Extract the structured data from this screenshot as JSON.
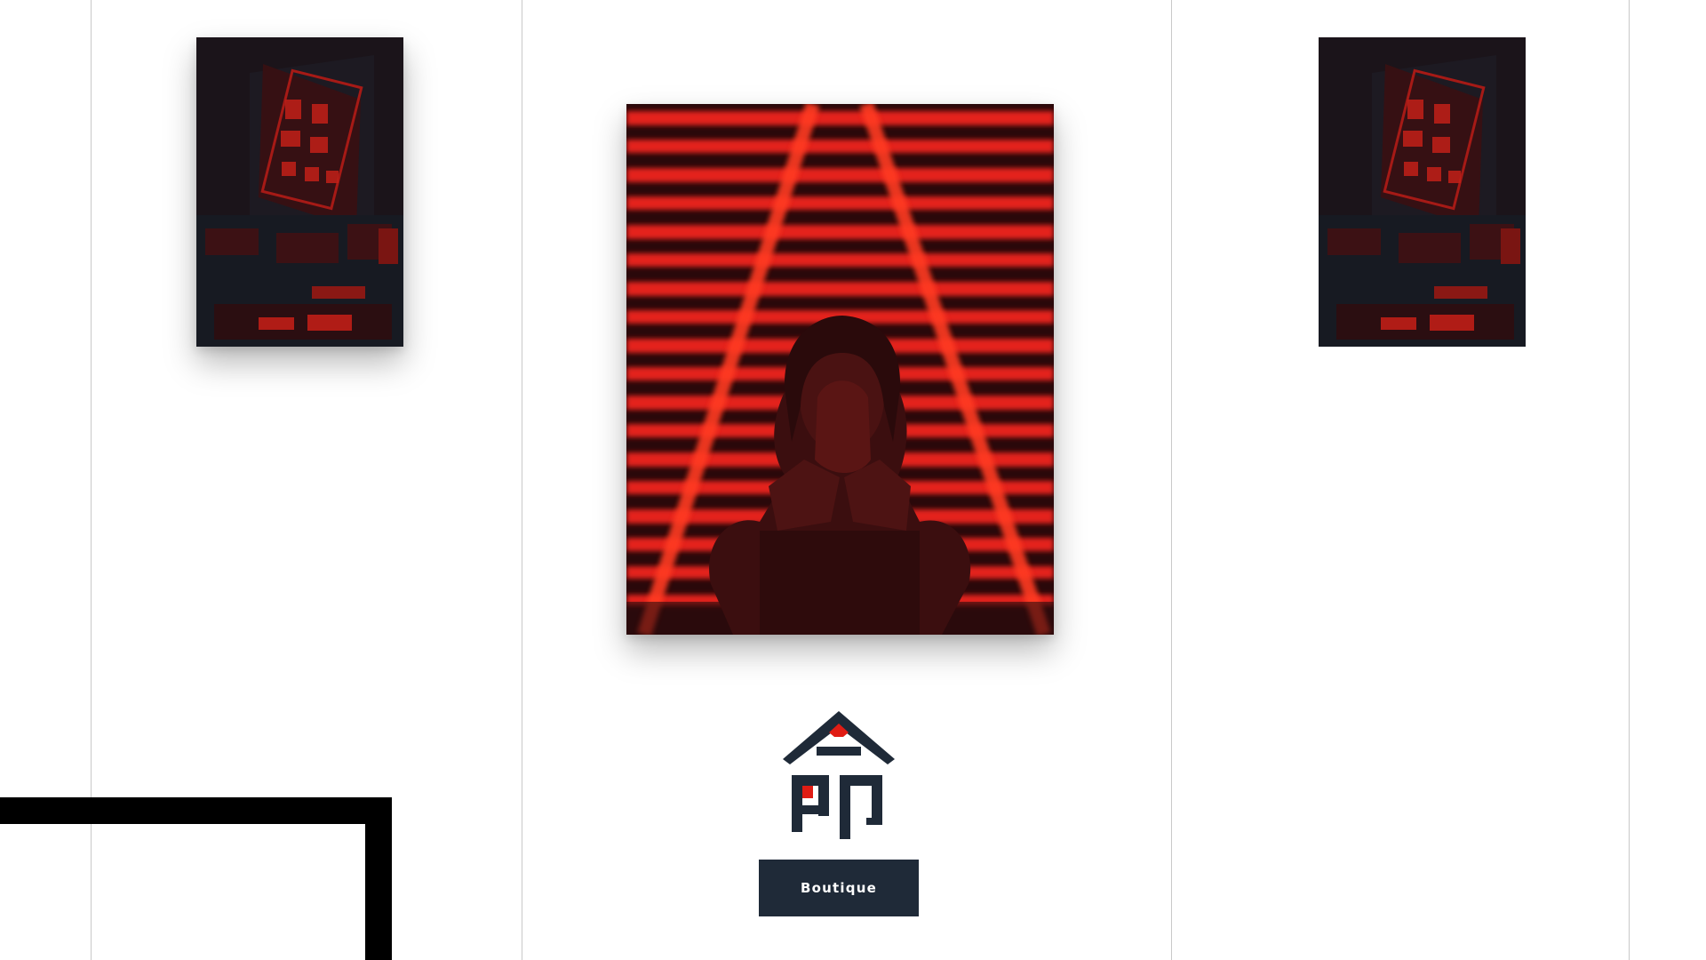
{
  "page": {
    "background_color": "#ffffff",
    "grid_line_color": "#c9c9c9",
    "accent_color": "#e01c14",
    "dark_color": "#1f2a38"
  },
  "gallery": {
    "left_photo": {
      "subject": "neon-sign-street-night"
    },
    "center_photo": {
      "subject": "hooded-figure-red-neon-lines"
    },
    "right_photo": {
      "subject": "neon-sign-street-night"
    }
  },
  "logo": {
    "icon": "kanji-mei-logo",
    "glyph": "命"
  },
  "cta": {
    "label": "Boutique"
  }
}
